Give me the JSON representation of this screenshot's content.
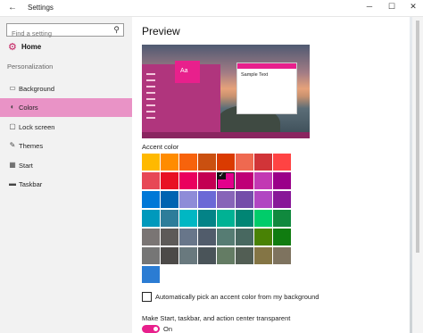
{
  "window": {
    "title": "Settings",
    "back_glyph": "←",
    "minimize_glyph": "─",
    "maximize_glyph": "☐",
    "close_glyph": "✕"
  },
  "sidebar": {
    "search_placeholder": "Find a setting",
    "search_icon": "search-icon",
    "home_label": "Home",
    "home_icon": "gear-icon",
    "section_label": "Personalization",
    "items": [
      {
        "label": "Background",
        "icon": "picture-icon",
        "glyph": "▭",
        "active": false
      },
      {
        "label": "Colors",
        "icon": "palette-icon",
        "glyph": "◐",
        "active": true
      },
      {
        "label": "Lock screen",
        "icon": "monitor-icon",
        "glyph": "▢",
        "active": false
      },
      {
        "label": "Themes",
        "icon": "brush-icon",
        "glyph": "✎",
        "active": false
      },
      {
        "label": "Start",
        "icon": "start-icon",
        "glyph": "▦",
        "active": false
      },
      {
        "label": "Taskbar",
        "icon": "taskbar-icon",
        "glyph": "▬",
        "active": false
      }
    ]
  },
  "main": {
    "preview_heading": "Preview",
    "preview_tile_text": "Aa",
    "preview_sample_text": "Sample Text",
    "accent_label": "Accent color",
    "selected_swatch": "r1c4",
    "swatch_rows": [
      [
        "#FFB900",
        "#FF8C00",
        "#F7630C",
        "#CA5010",
        "#DA3B01",
        "#EF6950",
        "#D13438",
        "#FF4343"
      ],
      [
        "#E74856",
        "#E81123",
        "#EA005E",
        "#C30052",
        "#E3008C",
        "#BF0077",
        "#C239B3",
        "#9A0089"
      ],
      [
        "#0078D7",
        "#0063B1",
        "#8E8CD8",
        "#6B69D6",
        "#8764B8",
        "#744DA9",
        "#B146C2",
        "#881798"
      ],
      [
        "#0099BC",
        "#2D7D9A",
        "#00B7C3",
        "#038387",
        "#00B294",
        "#018574",
        "#00CC6A",
        "#10893E"
      ],
      [
        "#7A7574",
        "#5D5A58",
        "#68768A",
        "#515C6B",
        "#567C73",
        "#486860",
        "#498205",
        "#107C10"
      ],
      [
        "#767676",
        "#4C4A48",
        "#69797E",
        "#4A5459",
        "#647C64",
        "#525E54",
        "#847545",
        "#7E735F"
      ],
      [
        "#2B7CD3"
      ]
    ],
    "auto_pick_label": "Automatically pick an accent color from my background",
    "auto_pick_checked": false,
    "transparent_label": "Make Start, taskbar, and action center transparent",
    "transparent_toggle_label": "On",
    "transparent_on": true,
    "accent_color": "#E8208C"
  }
}
